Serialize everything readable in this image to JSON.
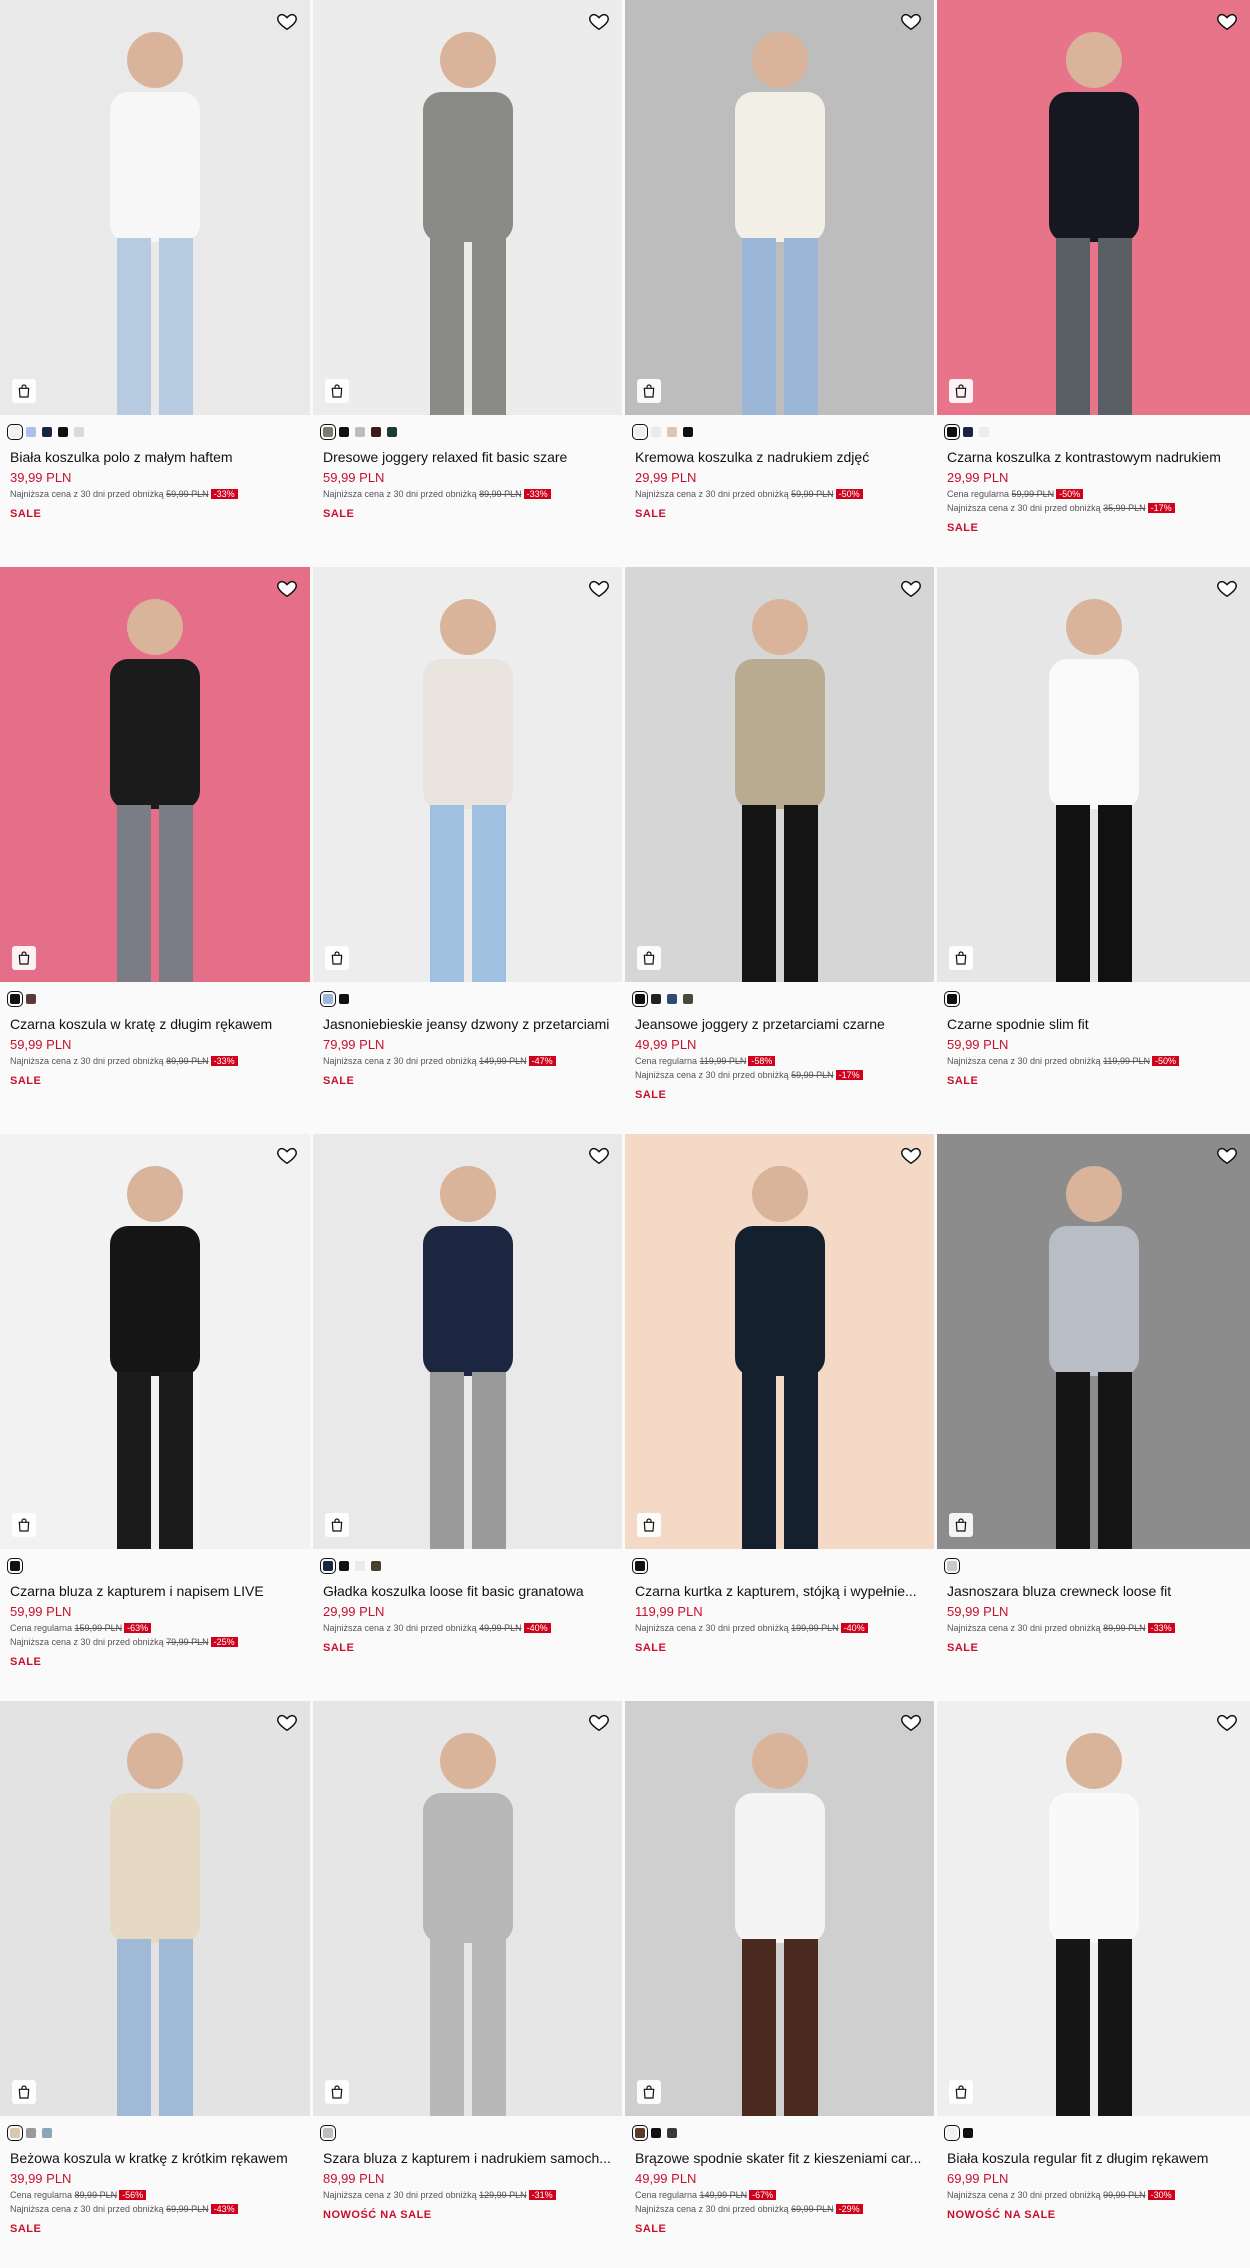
{
  "products": [
    {
      "title": "Biała koszulka polo z małym haftem",
      "price": "39,99 PLN",
      "regular": "",
      "regular_badge": "",
      "lowest_old": "59,99 PLN",
      "lowest_badge": "-33%",
      "tag": "SALE",
      "bg": "#e9e9e9",
      "swatches": [
        "#f2f2f2",
        "#a9c2e8",
        "#1a2540",
        "#111111",
        "#d9d9e6"
      ]
    },
    {
      "title": "Dresowe joggery relaxed fit basic szare",
      "price": "59,99 PLN",
      "regular": "",
      "regular_badge": "",
      "lowest_old": "89,99 PLN",
      "lowest_badge": "-33%",
      "tag": "SALE",
      "bg": "#ececec",
      "swatches": [
        "#7b7b6e",
        "#111111",
        "#bdbdbd",
        "#3a1c1c",
        "#1f3b34"
      ]
    },
    {
      "title": "Kremowa koszulka z nadrukiem zdjęć",
      "price": "29,99 PLN",
      "regular": "",
      "regular_badge": "",
      "lowest_old": "59,99 PLN",
      "lowest_badge": "-50%",
      "tag": "SALE",
      "bg": "#bdbdbd",
      "swatches": [
        "#f2efe6",
        "#e9e9ee",
        "#d8c8b0",
        "#111111"
      ]
    },
    {
      "title": "Czarna koszulka z kontrastowym nadrukiem",
      "price": "29,99 PLN",
      "regular": "59,99 PLN",
      "regular_badge": "-50%",
      "lowest_old": "35,99 PLN",
      "lowest_badge": "-17%",
      "tag": "SALE",
      "bg": "#e8748a",
      "swatches": [
        "#111111",
        "#1a2540",
        "#ececec"
      ]
    },
    {
      "title": "Czarna koszula w kratę z długim rękawem",
      "price": "59,99 PLN",
      "regular": "",
      "regular_badge": "",
      "lowest_old": "89,99 PLN",
      "lowest_badge": "-33%",
      "tag": "SALE",
      "bg": "#e56e88",
      "swatches": [
        "#111111",
        "#5a3b3b"
      ]
    },
    {
      "title": "Jasnoniebieskie jeansy dzwony z przetarciami",
      "price": "79,99 PLN",
      "regular": "",
      "regular_badge": "",
      "lowest_old": "149,99 PLN",
      "lowest_badge": "-47%",
      "tag": "SALE",
      "bg": "#ededed",
      "swatches": [
        "#9bb6d6",
        "#111111"
      ]
    },
    {
      "title": "Jeansowe joggery z przetarciami czarne",
      "price": "49,99 PLN",
      "regular": "119,99 PLN",
      "regular_badge": "-58%",
      "lowest_old": "59,99 PLN",
      "lowest_badge": "-17%",
      "tag": "SALE",
      "bg": "#d6d6d6",
      "swatches": [
        "#111111",
        "#222222",
        "#2d4a78",
        "#4a4a3a"
      ]
    },
    {
      "title": "Czarne spodnie slim fit",
      "price": "59,99 PLN",
      "regular": "",
      "regular_badge": "",
      "lowest_old": "119,99 PLN",
      "lowest_badge": "-50%",
      "tag": "SALE",
      "bg": "#e6e6e6",
      "swatches": [
        "#111111"
      ]
    },
    {
      "title": "Czarna bluza z kapturem i napisem LIVE",
      "price": "59,99 PLN",
      "regular": "159,99 PLN",
      "regular_badge": "-63%",
      "lowest_old": "79,99 PLN",
      "lowest_badge": "-25%",
      "tag": "SALE",
      "bg": "#f2f2f2",
      "swatches": [
        "#111111"
      ]
    },
    {
      "title": "Gładka koszulka loose fit basic granatowa",
      "price": "29,99 PLN",
      "regular": "",
      "regular_badge": "",
      "lowest_old": "49,99 PLN",
      "lowest_badge": "-40%",
      "tag": "SALE",
      "bg": "#e9e9e9",
      "swatches": [
        "#1a2540",
        "#111111",
        "#ececec",
        "#4a4030"
      ]
    },
    {
      "title": "Czarna kurtka z kapturem, stójką i wypełnie...",
      "price": "119,99 PLN",
      "regular": "",
      "regular_badge": "",
      "lowest_old": "199,99 PLN",
      "lowest_badge": "-40%",
      "tag": "SALE",
      "bg": "#f3d9c6",
      "swatches": [
        "#111111"
      ]
    },
    {
      "title": "Jasnoszara bluza crewneck loose fit",
      "price": "59,99 PLN",
      "regular": "",
      "regular_badge": "",
      "lowest_old": "89,99 PLN",
      "lowest_badge": "-33%",
      "tag": "SALE",
      "bg": "#8c8c8c",
      "swatches": [
        "#c9c9c9"
      ]
    },
    {
      "title": "Beżowa koszula w kratkę z krótkim rękawem",
      "price": "39,99 PLN",
      "regular": "89,99 PLN",
      "regular_badge": "-56%",
      "lowest_old": "69,99 PLN",
      "lowest_badge": "-43%",
      "tag": "SALE",
      "bg": "#e3e3e3",
      "swatches": [
        "#d8c8b0",
        "#9a9a9a",
        "#8aa6b8"
      ]
    },
    {
      "title": "Szara bluza z kapturem i nadrukiem samoch...",
      "price": "89,99 PLN",
      "regular": "",
      "regular_badge": "",
      "lowest_old": "129,99 PLN",
      "lowest_badge": "-31%",
      "tag": "NOWOŚĆ NA SALE",
      "bg": "#e6e6e6",
      "swatches": [
        "#bdbdbd"
      ]
    },
    {
      "title": "Brązowe spodnie skater fit z kieszeniami car...",
      "price": "49,99 PLN",
      "regular": "149,99 PLN",
      "regular_badge": "-67%",
      "lowest_old": "69,99 PLN",
      "lowest_badge": "-29%",
      "tag": "SALE",
      "bg": "#cfcfcf",
      "swatches": [
        "#5a3a2a",
        "#111111",
        "#3a3a3a"
      ]
    },
    {
      "title": "Biała koszula regular fit z długim rękawem",
      "price": "69,99 PLN",
      "regular": "",
      "regular_badge": "",
      "lowest_old": "99,99 PLN",
      "lowest_badge": "-30%",
      "tag": "NOWOŚĆ NA SALE",
      "bg": "#efefef",
      "swatches": [
        "#f2f2f2",
        "#111111"
      ]
    }
  ],
  "labels": {
    "regular_prefix": "Cena regularna",
    "lowest_prefix": "Najniższa cena z 30 dni przed obniżką"
  },
  "icons": {
    "favorite": "heart-icon",
    "cart": "shopping-bag-icon"
  }
}
